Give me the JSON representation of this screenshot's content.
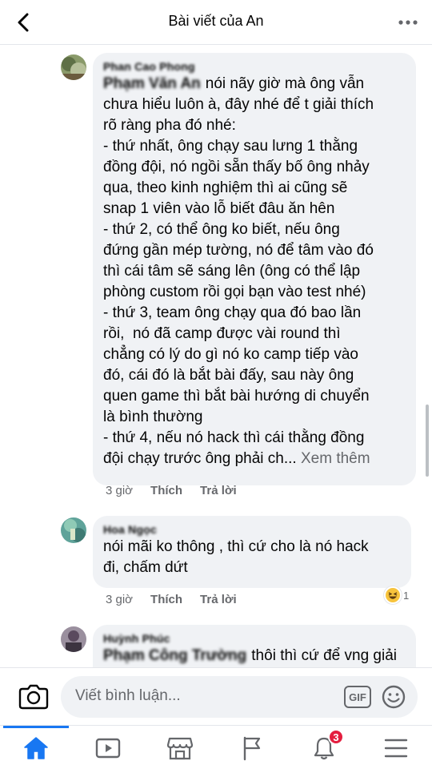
{
  "header": {
    "title": "Bài viết của An",
    "back_icon": "chevron-left-icon",
    "more_icon": "more-horizontal-icon"
  },
  "comments": [
    {
      "author": "Phan Cao Phong",
      "mention": "Phạm Văn An",
      "text": "nói nãy giờ mà ông vẫn\nchưa hiểu luôn à, đây nhé để t giải thích\nrõ ràng pha đó nhé:\n- thứ nhất, ông chạy sau lưng 1 thằng\nđồng đội, nó ngồi sẵn thấy bố ông nhảy\nqua, theo kinh nghiệm thì ai cũng sẽ\nsnap 1 viên vào lỗ biết đâu ăn hên\n- thứ 2, có thể ông ko biết, nếu ông\nđứng gần mép tường, nó để tâm vào đó\nthì cái tâm sẽ sáng lên (ông có thể lập\nphòng custom rồi gọi bạn vào test nhé)\n- thứ 3, team ông chạy qua đó bao lần\nrồi,  nó đã camp được vài round thì\nchẳng có lý do gì nó ko camp tiếp vào\nđó, cái đó là bắt bài đấy, sau này ông\nquen game thì bắt bài hướng di chuyển\nlà bình thường\n- thứ 4, nếu nó hack thì cái thằng đồng\nđội chạy trước ông phải ch...",
      "see_more": "Xem thêm",
      "time": "3 giờ",
      "like": "Thích",
      "reply": "Trả lời"
    },
    {
      "author": "Hoa Ngọc",
      "text": "nói mãi ko thông , thì cứ cho là nó hack\nđi, chấm dứt",
      "time": "3 giờ",
      "like": "Thích",
      "reply": "Trả lời",
      "reaction_icon": "haha-emoji-icon",
      "reaction_count": "1"
    },
    {
      "author": "Huỳnh Phúc",
      "mention": "Phạm Công Trường",
      "text": "thôi thì cứ để vng giải"
    }
  ],
  "composer": {
    "placeholder": "Viết bình luận...",
    "camera_icon": "camera-icon",
    "gif_label": "GIF",
    "emoji_icon": "smiley-icon"
  },
  "bottom_nav": {
    "items": [
      "home-icon",
      "watch-icon",
      "marketplace-icon",
      "pages-flag-icon",
      "notifications-bell-icon",
      "menu-icon"
    ],
    "notification_badge": "3",
    "accent": "#1877f2"
  }
}
